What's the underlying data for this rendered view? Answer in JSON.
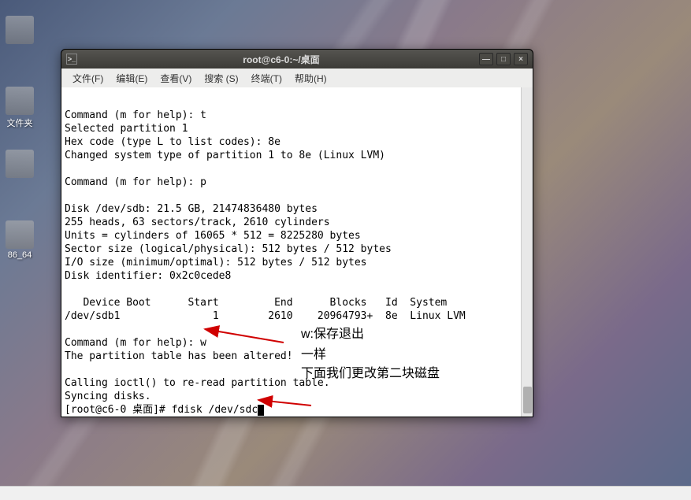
{
  "desktop": {
    "icon1_label": "文件夹",
    "icon2_label": "",
    "icon3_label": "86_64"
  },
  "window": {
    "title": "root@c6-0:~/桌面",
    "menu": {
      "file": "文件(F)",
      "edit": "编辑(E)",
      "view": "查看(V)",
      "search": "搜索 (S)",
      "terminal": "终端(T)",
      "help": "帮助(H)"
    }
  },
  "terminal": {
    "lines": [
      "",
      "Command (m for help): t",
      "Selected partition 1",
      "Hex code (type L to list codes): 8e",
      "Changed system type of partition 1 to 8e (Linux LVM)",
      "",
      "Command (m for help): p",
      "",
      "Disk /dev/sdb: 21.5 GB, 21474836480 bytes",
      "255 heads, 63 sectors/track, 2610 cylinders",
      "Units = cylinders of 16065 * 512 = 8225280 bytes",
      "Sector size (logical/physical): 512 bytes / 512 bytes",
      "I/O size (minimum/optimal): 512 bytes / 512 bytes",
      "Disk identifier: 0x2c0cede8",
      "",
      "   Device Boot      Start         End      Blocks   Id  System",
      "/dev/sdb1               1        2610    20964793+  8e  Linux LVM",
      "",
      "Command (m for help): w",
      "The partition table has been altered!",
      "",
      "Calling ioctl() to re-read partition table.",
      "Syncing disks.",
      "[root@c6-0 桌面]# fdisk /dev/sdc"
    ]
  },
  "annotations": {
    "a1": "w:保存退出",
    "a2": "一样",
    "a3": "下面我们更改第二块磁盘"
  },
  "bottom": {
    "text": ""
  }
}
